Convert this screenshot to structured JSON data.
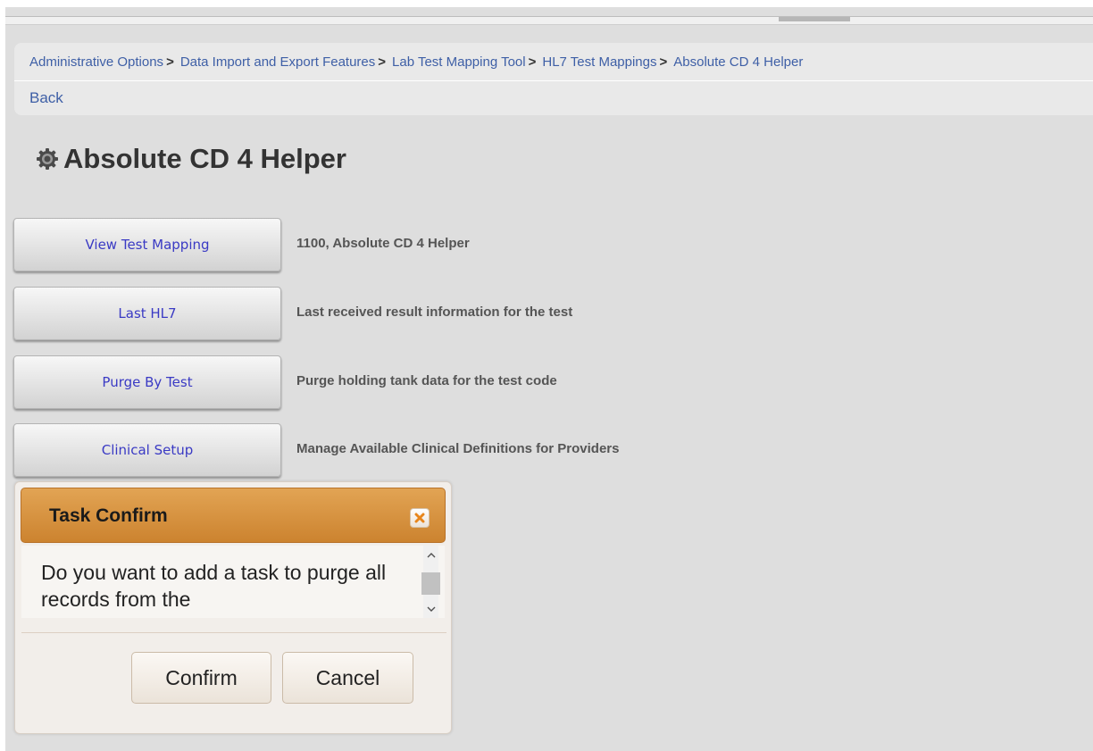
{
  "breadcrumb": {
    "items": [
      "Administrative Options",
      "Data Import and Export Features",
      "Lab Test Mapping Tool",
      "HL7 Test Mappings",
      "Absolute CD 4 Helper"
    ],
    "separator": ">"
  },
  "nav": {
    "back_label": "Back"
  },
  "page": {
    "title": "Absolute CD 4 Helper",
    "title_icon": "gear-icon"
  },
  "actions": [
    {
      "label": "View Test Mapping",
      "description": "1100, Absolute CD 4 Helper"
    },
    {
      "label": "Last HL7",
      "description": "Last received result information for the test"
    },
    {
      "label": "Purge By Test",
      "description": "Purge holding tank data for the test code"
    },
    {
      "label": "Clinical Setup",
      "description": "Manage Available Clinical Definitions for Providers"
    }
  ],
  "dialog": {
    "title": "Task Confirm",
    "message": "Do you want to add a task to purge all records from the",
    "confirm_label": "Confirm",
    "cancel_label": "Cancel",
    "close_icon": "close-icon"
  },
  "colors": {
    "link": "#3e5fa6",
    "button_text": "#3a3ac4",
    "dialog_header": "#d68f3c",
    "close_x": "#e8861c"
  }
}
